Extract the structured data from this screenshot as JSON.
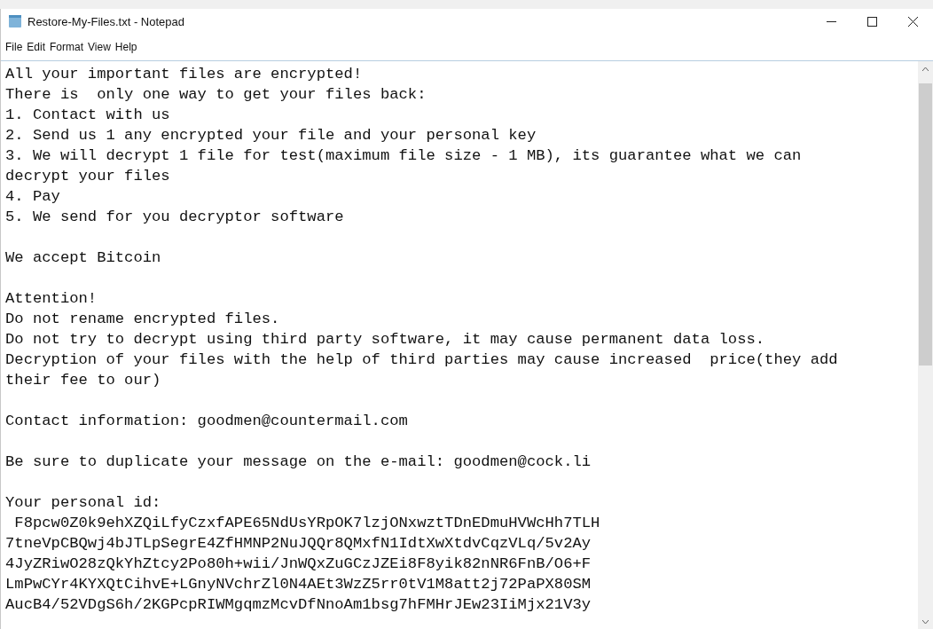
{
  "window": {
    "title": "Restore-My-Files.txt - Notepad"
  },
  "menu": [
    "File",
    "Edit",
    "Format",
    "View",
    "Help"
  ],
  "document": {
    "blocks": [
      {
        "lines": [
          "All your important files are encrypted!",
          "There is  only one way to get your files back:",
          "1. Contact with us",
          "2. Send us 1 any encrypted your file and your personal key",
          "3. We will decrypt 1 file for test(maximum file size - 1 MB), its guarantee what we can",
          "decrypt your files",
          "4. Pay",
          "5. We send for you decryptor software"
        ]
      },
      {
        "lines": [
          "We accept Bitcoin"
        ]
      },
      {
        "lines": [
          "Attention!",
          "Do not rename encrypted files.",
          "Do not try to decrypt using third party software, it may cause permanent data loss.",
          "Decryption of your files with the help of third parties may cause increased  price(they add",
          "their fee to our)"
        ]
      },
      {
        "lines": [
          "Contact information: goodmen@countermail.com"
        ]
      },
      {
        "lines": [
          "Be sure to duplicate your message on the e-mail: goodmen@cock.li"
        ]
      },
      {
        "lines": [
          "Your personal id:",
          " F8pcw0Z0k9ehXZQiLfyCzxfAPE65NdUsYRpOK7lzjONxwztTDnEDmuHVWcHh7TLH",
          "7tneVpCBQwj4bJTLpSegrE4ZfHMNP2NuJQQr8QMxfN1IdtXwXtdvCqzVLq/5v2Ay",
          "4JyZRiwO28zQkYhZtcy2Po80h+wii/JnWQxZuGCzJZEi8F8yik82nNR6FnB/O6+F",
          "LmPwCYr4KYXQtCihvE+LGnyNVchrZl0N4AEt3WzZ5rr0tV1M8att2j72PaPX80SM",
          "AucB4/52VDgS6h/2KGPcpRIWMgqmzMcvDfNnoAm1bsg7hFMHrJEw23IiMjx21V3y"
        ]
      }
    ]
  }
}
